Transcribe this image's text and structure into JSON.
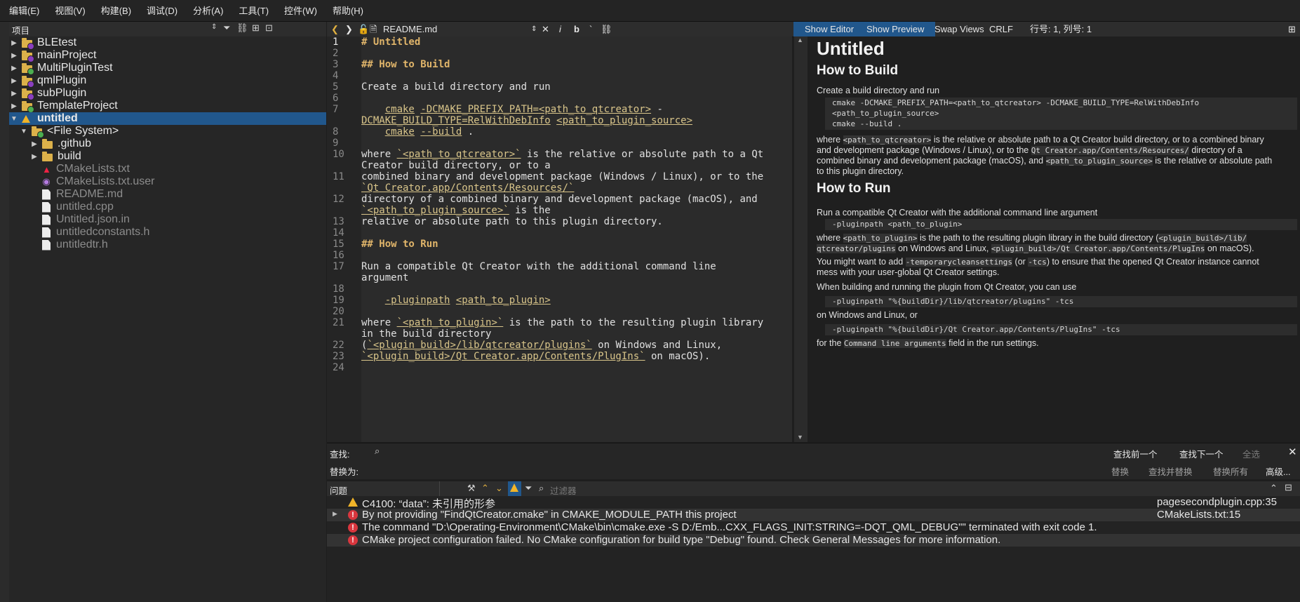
{
  "menubar": [
    "编辑(E)",
    "视图(V)",
    "构建(B)",
    "调试(D)",
    "分析(A)",
    "工具(T)",
    "控件(W)",
    "帮助(H)"
  ],
  "project_panel": {
    "title": "项目",
    "items": [
      {
        "label": "BLEtest",
        "level": 0,
        "type": "project",
        "expanded": false
      },
      {
        "label": "mainProject",
        "level": 0,
        "type": "project",
        "expanded": false
      },
      {
        "label": "MultiPluginTest",
        "level": 0,
        "type": "project",
        "expanded": false
      },
      {
        "label": "qmlPlugin",
        "level": 0,
        "type": "project",
        "expanded": false
      },
      {
        "label": "subPlugin",
        "level": 0,
        "type": "project",
        "expanded": false
      },
      {
        "label": "TemplateProject",
        "level": 0,
        "type": "project",
        "expanded": false
      },
      {
        "label": "untitled",
        "level": 0,
        "type": "project-warning",
        "expanded": true,
        "selected": true
      },
      {
        "label": "<File System>",
        "level": 1,
        "type": "filesystem",
        "expanded": true
      },
      {
        "label": ".github",
        "level": 2,
        "type": "folder"
      },
      {
        "label": "build",
        "level": 2,
        "type": "folder"
      },
      {
        "label": "CMakeLists.txt",
        "level": 2,
        "type": "cmake"
      },
      {
        "label": "CMakeLists.txt.user",
        "level": 2,
        "type": "user"
      },
      {
        "label": "README.md",
        "level": 2,
        "type": "file"
      },
      {
        "label": "untitled.cpp",
        "level": 2,
        "type": "file"
      },
      {
        "label": "Untitled.json.in",
        "level": 2,
        "type": "file"
      },
      {
        "label": "untitledconstants.h",
        "level": 2,
        "type": "file"
      },
      {
        "label": "untitledtr.h",
        "level": 2,
        "type": "file"
      }
    ]
  },
  "editor_toolbar": {
    "filename": "README.md",
    "format_buttons": [
      "i",
      "b",
      "`"
    ],
    "tabs": [
      "Show Editor",
      "Show Preview",
      "Swap Views"
    ],
    "line_ending": "CRLF",
    "position": "行号: 1, 列号: 1"
  },
  "code_lines": [
    {
      "n": "1",
      "text": "# Untitled"
    },
    {
      "n": "2",
      "text": ""
    },
    {
      "n": "3",
      "text": "## How to Build"
    },
    {
      "n": "4",
      "text": ""
    },
    {
      "n": "5",
      "text": "Create a build directory and run"
    },
    {
      "n": "6",
      "text": ""
    },
    {
      "n": "7",
      "text": "    cmake -DCMAKE_PREFIX_PATH=<path_to_qtcreator> -"
    },
    {
      "n": "",
      "text": "DCMAKE_BUILD_TYPE=RelWithDebInfo <path_to_plugin_source>"
    },
    {
      "n": "8",
      "text": "    cmake --build ."
    },
    {
      "n": "9",
      "text": ""
    },
    {
      "n": "10",
      "text": "where `<path_to_qtcreator>` is the relative or absolute path to a Qt"
    },
    {
      "n": "",
      "text": "Creator build directory, or to a"
    },
    {
      "n": "11",
      "text": "combined binary and development package (Windows / Linux), or to the"
    },
    {
      "n": "",
      "text": "`Qt Creator.app/Contents/Resources/`"
    },
    {
      "n": "12",
      "text": "directory of a combined binary and development package (macOS), and"
    },
    {
      "n": "",
      "text": "`<path_to_plugin_source>` is the"
    },
    {
      "n": "13",
      "text": "relative or absolute path to this plugin directory."
    },
    {
      "n": "14",
      "text": ""
    },
    {
      "n": "15",
      "text": "## How to Run"
    },
    {
      "n": "16",
      "text": ""
    },
    {
      "n": "17",
      "text": "Run a compatible Qt Creator with the additional command line"
    },
    {
      "n": "",
      "text": "argument"
    },
    {
      "n": "18",
      "text": ""
    },
    {
      "n": "19",
      "text": "    -pluginpath <path_to_plugin>"
    },
    {
      "n": "20",
      "text": ""
    },
    {
      "n": "21",
      "text": "where `<path_to_plugin>` is the path to the resulting plugin library"
    },
    {
      "n": "",
      "text": "in the build directory"
    },
    {
      "n": "22",
      "text": "(`<plugin_build>/lib/qtcreator/plugins` on Windows and Linux,"
    },
    {
      "n": "23",
      "text": "`<plugin_build>/Qt Creator.app/Contents/PlugIns` on macOS)."
    },
    {
      "n": "24",
      "text": ""
    }
  ],
  "preview": {
    "h1": "Untitled",
    "h2_build": "How to Build",
    "p_create": "Create a build directory and run",
    "pre_build_1": "cmake -DCMAKE_PREFIX_PATH=<path_to_qtcreator> -DCMAKE_BUILD_TYPE=RelWithDebInfo",
    "pre_build_2": "<path_to_plugin_source>",
    "pre_build_3": "cmake --build .",
    "p_where1": "is the relative or absolute path to a Qt Creator build directory, or to a combined binary",
    "p_where1_code": "<path_to_qtcreator>",
    "p_where1_prefix": "where",
    "p_where2_a": "and development package (Windows / Linux), or to the",
    "p_where2_code": "Qt Creator.app/Contents/Resources/",
    "p_where2_b": "directory of a",
    "p_where3_a": "combined binary and development package (macOS), and",
    "p_where3_code": "<path_to_plugin_source>",
    "p_where3_b": "is the relative or absolute path",
    "p_where4": "to this plugin directory.",
    "h2_run": "How to Run",
    "p_run": "Run a compatible Qt Creator with the additional command line argument",
    "pre_run": "-pluginpath <path_to_plugin>",
    "p_where_plugin_a": "where",
    "p_where_plugin_code": "<path_to_plugin>",
    "p_where_plugin_b": "is the path to the resulting plugin library in the build directory (",
    "p_where_plugin_code2": "<plugin_build>/lib/",
    "p_where_plugin_c_code": "qtcreator/plugins",
    "p_where_plugin_d": "on Windows and Linux,",
    "p_where_plugin_code3": "<plugin_build>/Qt Creator.app/Contents/PlugIns",
    "p_where_plugin_e": "on macOS).",
    "p_might_a": "You might want to add",
    "p_might_code": "-temporarycleansettings",
    "p_might_b": "(or",
    "p_might_code2": "-tcs",
    "p_might_c": ") to ensure that the opened Qt Creator instance cannot",
    "p_might2": "mess with your user-global Qt Creator settings.",
    "p_when": "When building and running the plugin from Qt Creator, you can use",
    "pre_when1": "-pluginpath \"%{buildDir}/lib/qtcreator/plugins\" -tcs",
    "p_onwin": "on Windows and Linux, or",
    "pre_when2": "-pluginpath \"%{buildDir}/Qt Creator.app/Contents/PlugIns\" -tcs",
    "p_for_a": "for the",
    "p_for_code": "Command line arguments",
    "p_for_b": "field in the run settings."
  },
  "findbar": {
    "find_label": "查找:",
    "replace_label": "替换为:",
    "find_prev": "查找前一个",
    "find_next": "查找下一个",
    "select_all": "全选",
    "replace": "替换",
    "replace_find": "查找并替换",
    "replace_all": "替换所有",
    "advanced": "高级..."
  },
  "issues_panel": {
    "title": "问题",
    "filter_placeholder": "过滤器",
    "rows": [
      {
        "kind": "warning",
        "text": "C4100: “data”: 未引用的形参",
        "location": "pagesecondplugin.cpp:35"
      },
      {
        "kind": "error",
        "text": "By not providing \"FindQtCreator.cmake\" in CMAKE_MODULE_PATH this project",
        "location": "CMakeLists.txt:15"
      },
      {
        "kind": "error",
        "text": "The command \"D:\\Operating-Environment\\CMake\\bin\\cmake.exe -S D:/Emb...CXX_FLAGS_INIT:STRING=-DQT_QML_DEBUG\"\" terminated with exit code 1.",
        "location": ""
      },
      {
        "kind": "error",
        "text": "CMake project configuration failed. No CMake configuration for build type \"Debug\" found. Check General Messages for more information.",
        "location": ""
      }
    ]
  },
  "colors": {
    "accent": "#21578c",
    "warning": "#f0b429",
    "error": "#d9363e",
    "folder": "#dcb14a"
  }
}
